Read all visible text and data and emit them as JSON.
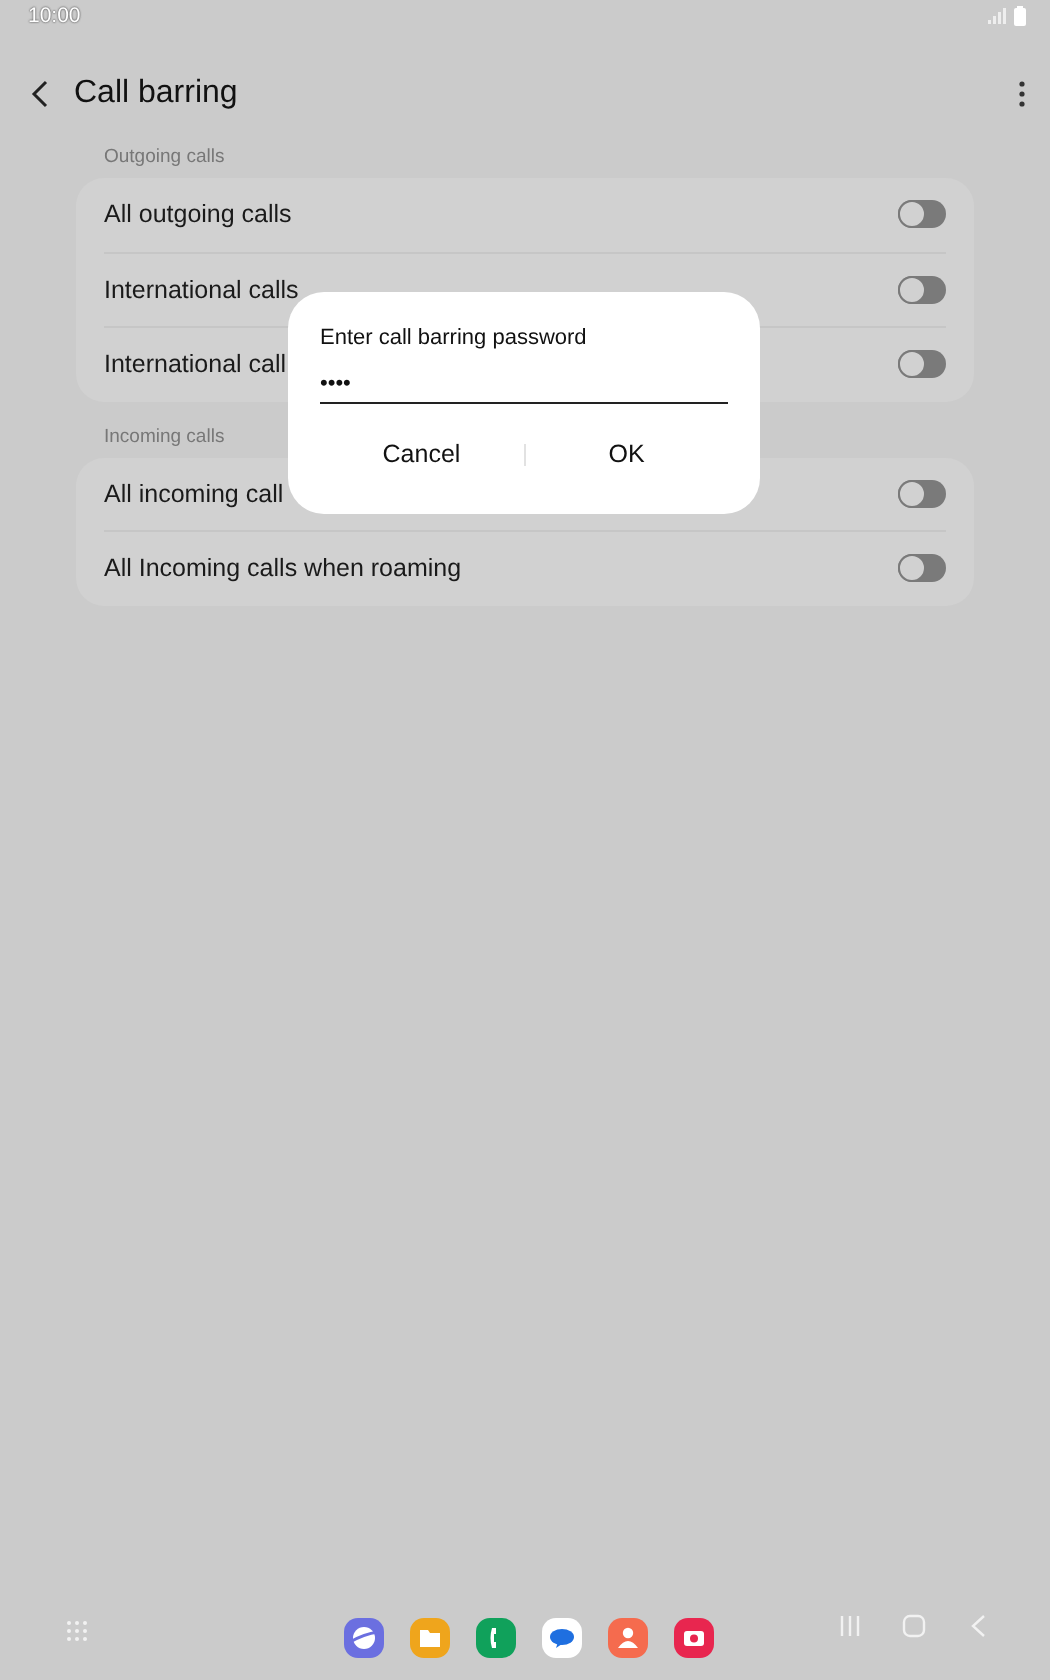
{
  "status_bar": {
    "time": "10:00"
  },
  "header": {
    "title": "Call barring"
  },
  "sections": [
    {
      "title": "Outgoing calls",
      "rows": [
        {
          "label": "All outgoing calls",
          "on": false
        },
        {
          "label": "International calls",
          "on": false
        },
        {
          "label": "International call",
          "on": false
        }
      ]
    },
    {
      "title": "Incoming calls",
      "rows": [
        {
          "label": "All incoming call",
          "on": false
        },
        {
          "label": "All Incoming calls when roaming",
          "on": false
        }
      ]
    }
  ],
  "dialog": {
    "title": "Enter call barring password",
    "value": "••••",
    "buttons": [
      "Cancel",
      "OK"
    ]
  },
  "dock": {
    "apps": [
      {
        "kind": "browser"
      },
      {
        "kind": "files"
      },
      {
        "kind": "phone"
      },
      {
        "kind": "messages"
      },
      {
        "kind": "contacts"
      },
      {
        "kind": "camera"
      }
    ]
  }
}
